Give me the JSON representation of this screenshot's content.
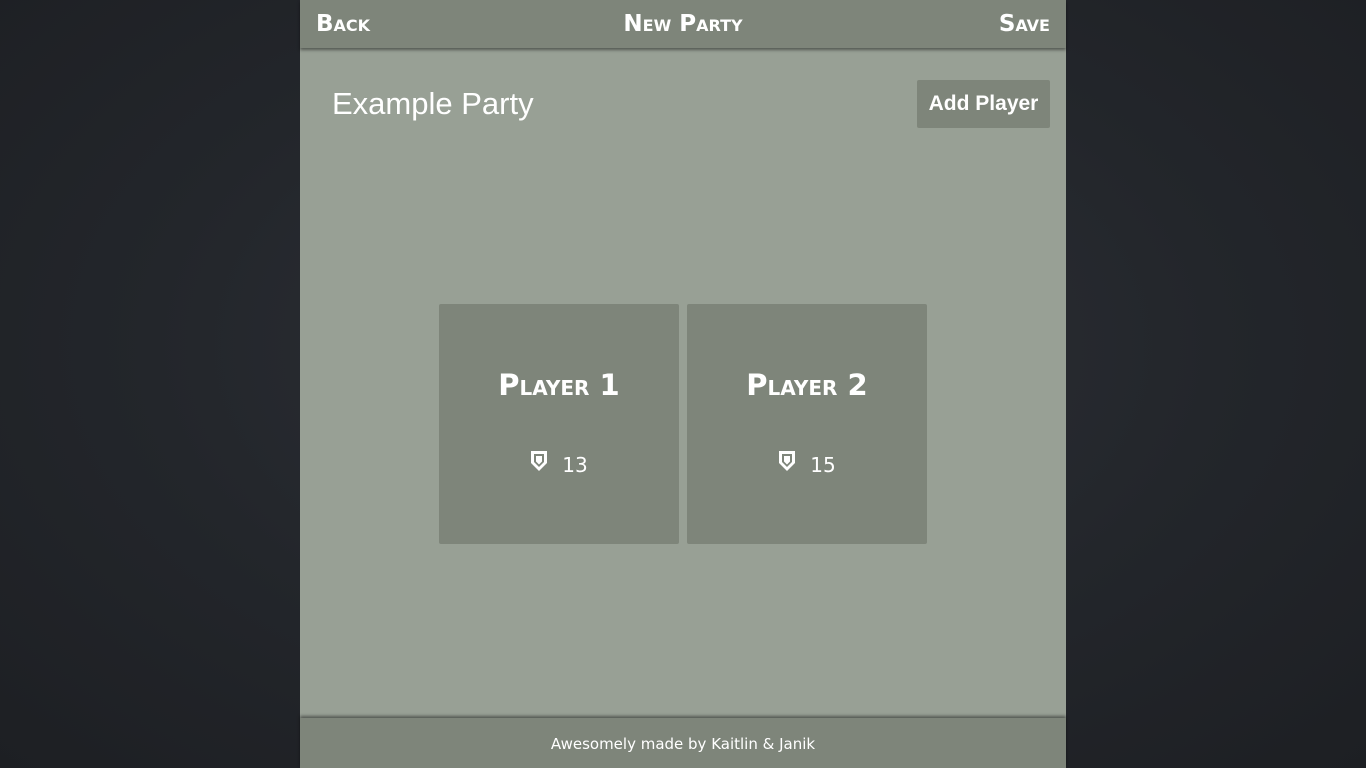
{
  "header": {
    "back_label": "Back",
    "title": "New Party",
    "save_label": "Save"
  },
  "party": {
    "name": "Example Party",
    "add_player_label": "Add Player"
  },
  "players": [
    {
      "name": "Player 1",
      "icon": "shield-icon",
      "value": "13"
    },
    {
      "name": "Player 2",
      "icon": "shield-icon",
      "value": "15"
    }
  ],
  "footer": {
    "credit": "Awesomely made by Kaitlin & Janik"
  },
  "colors": {
    "accent": "#7e857a",
    "panel": "#98a095",
    "backdrop": "#23262b",
    "text": "#ffffff"
  }
}
